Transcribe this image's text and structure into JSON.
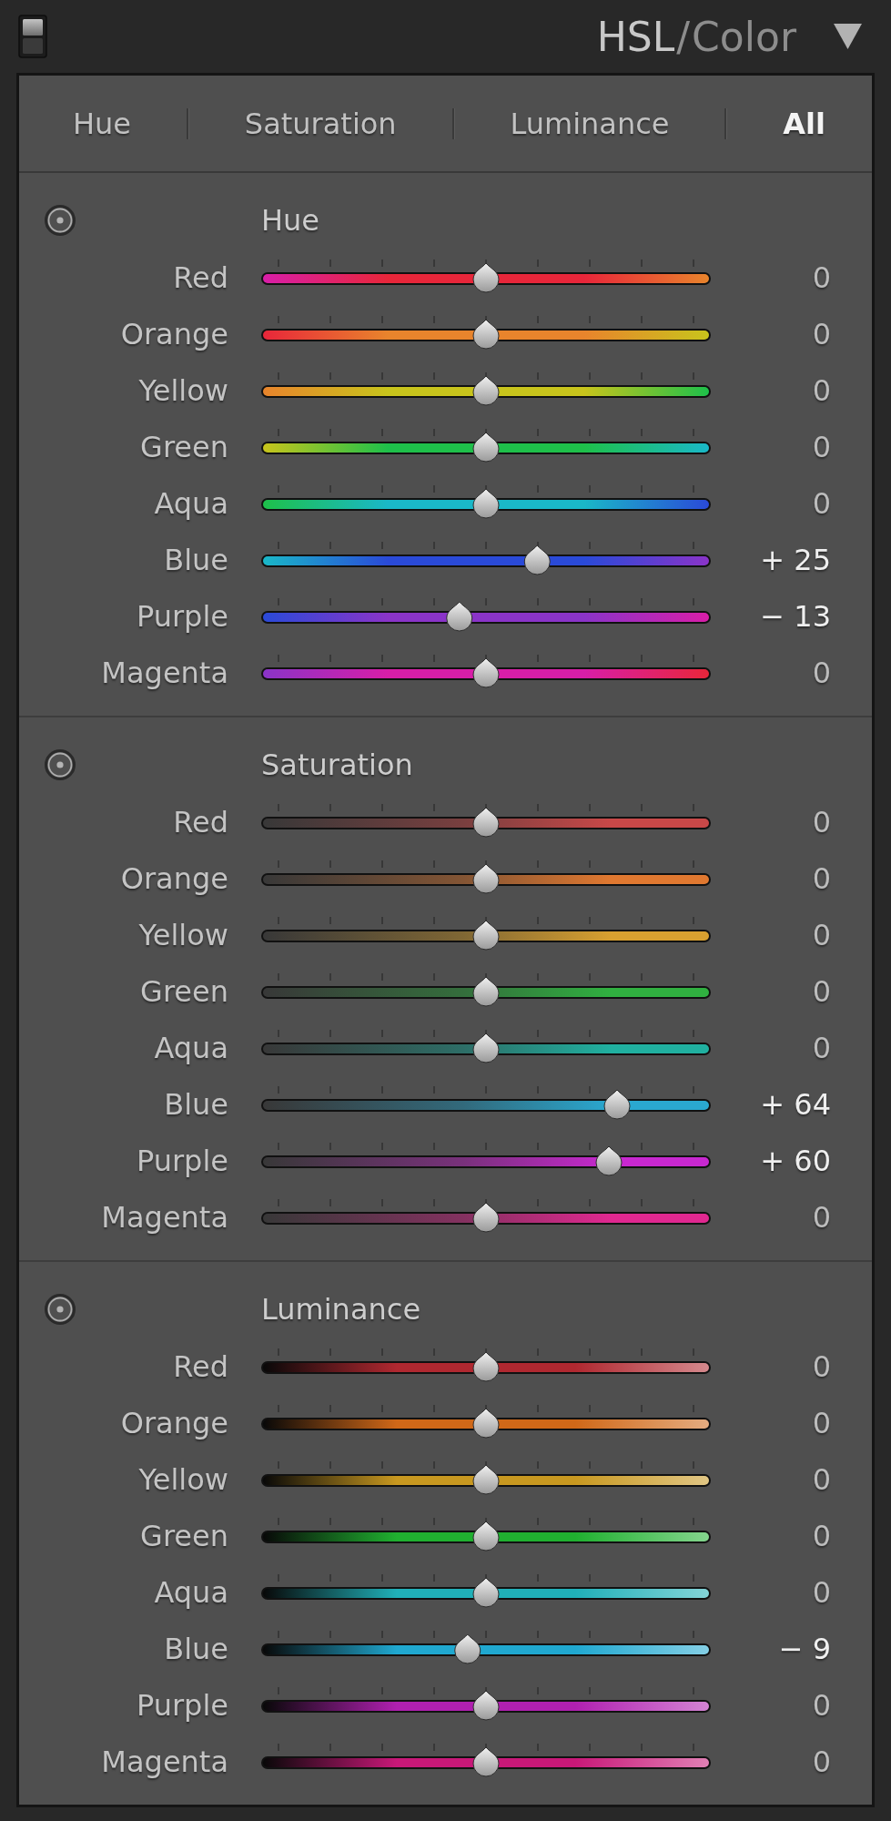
{
  "panel_title": {
    "items": [
      {
        "label": "HSL",
        "selected": true
      },
      {
        "label": "Color",
        "selected": false
      }
    ],
    "separator": "/"
  },
  "tabs": [
    {
      "label": "Hue",
      "selected": false
    },
    {
      "label": "Saturation",
      "selected": false
    },
    {
      "label": "Luminance",
      "selected": false
    },
    {
      "label": "All",
      "selected": true
    }
  ],
  "sections": [
    {
      "kind": "hue",
      "title": "Hue",
      "sliders": [
        {
          "label": "Red",
          "value": "0",
          "level": 0.5,
          "color": "#e8263a"
        },
        {
          "label": "Orange",
          "value": "0",
          "level": 0.5,
          "color": "#e8842c"
        },
        {
          "label": "Yellow",
          "value": "0",
          "level": 0.5,
          "color": "#c8c41c"
        },
        {
          "label": "Green",
          "value": "0",
          "level": 0.5,
          "color": "#1ec04a"
        },
        {
          "label": "Aqua",
          "value": "0",
          "level": 0.5,
          "color": "#1ab8c8"
        },
        {
          "label": "Blue",
          "value": "+ 25",
          "level": 0.625,
          "color": "#2a4ad8"
        },
        {
          "label": "Purple",
          "value": "− 13",
          "level": 0.435,
          "color": "#8a34c8"
        },
        {
          "label": "Magenta",
          "value": "0",
          "level": 0.5,
          "color": "#d81ea8"
        }
      ]
    },
    {
      "kind": "saturation",
      "title": "Saturation",
      "sliders": [
        {
          "label": "Red",
          "value": "0",
          "level": 0.5,
          "color": "#c84848"
        },
        {
          "label": "Orange",
          "value": "0",
          "level": 0.5,
          "color": "#e07830"
        },
        {
          "label": "Yellow",
          "value": "0",
          "level": 0.5,
          "color": "#d8a030"
        },
        {
          "label": "Green",
          "value": "0",
          "level": 0.5,
          "color": "#30b040"
        },
        {
          "label": "Aqua",
          "value": "0",
          "level": 0.5,
          "color": "#20b0a0"
        },
        {
          "label": "Blue",
          "value": "+ 64",
          "level": 0.82,
          "color": "#2aa8d0"
        },
        {
          "label": "Purple",
          "value": "+ 60",
          "level": 0.8,
          "color": "#c828d0"
        },
        {
          "label": "Magenta",
          "value": "0",
          "level": 0.5,
          "color": "#e02890"
        }
      ]
    },
    {
      "kind": "luminance",
      "title": "Luminance",
      "sliders": [
        {
          "label": "Red",
          "value": "0",
          "level": 0.5,
          "color": "#b02830"
        },
        {
          "label": "Orange",
          "value": "0",
          "level": 0.5,
          "color": "#d06818"
        },
        {
          "label": "Yellow",
          "value": "0",
          "level": 0.5,
          "color": "#c89820"
        },
        {
          "label": "Green",
          "value": "0",
          "level": 0.5,
          "color": "#20b030"
        },
        {
          "label": "Aqua",
          "value": "0",
          "level": 0.5,
          "color": "#20b0b8"
        },
        {
          "label": "Blue",
          "value": "− 9",
          "level": 0.455,
          "color": "#20a8d0"
        },
        {
          "label": "Purple",
          "value": "0",
          "level": 0.5,
          "color": "#b020b0"
        },
        {
          "label": "Magenta",
          "value": "0",
          "level": 0.5,
          "color": "#c81878"
        }
      ]
    }
  ]
}
